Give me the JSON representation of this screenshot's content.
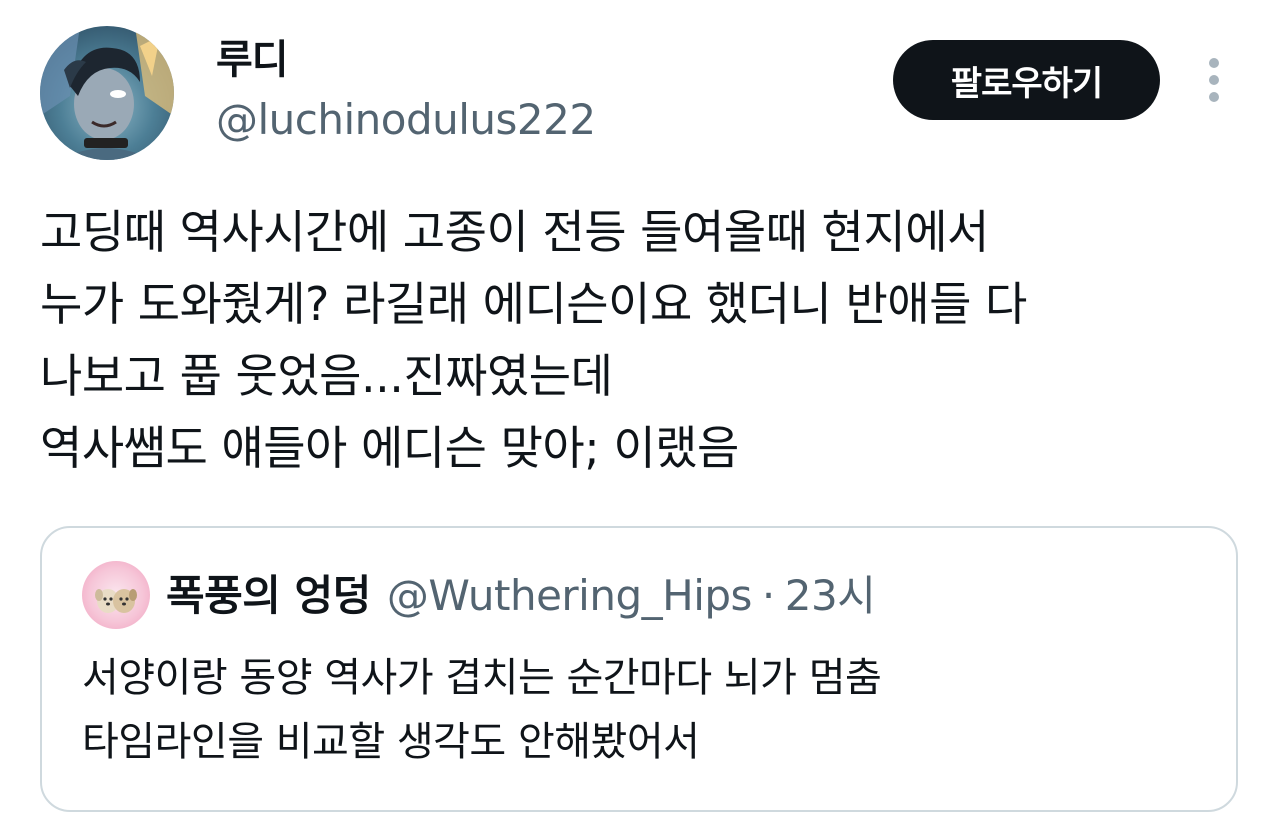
{
  "author": {
    "display_name": "루디",
    "handle": "@luchinodulus222",
    "avatar_icon": "profile-avatar"
  },
  "actions": {
    "follow_label": "팔로우하기",
    "more_icon": "more-vertical-icon"
  },
  "tweet": {
    "lines": [
      "고딩때 역사시간에 고종이 전등 들여올때 현지에서",
      "누가 도와줬게? 라길래 에디슨이요 했더니 반애들 다",
      "나보고 풉 웃었음...진짜였는데",
      "역사쌤도 얘들아 에디슨 맞아; 이랬음"
    ]
  },
  "quoted": {
    "display_name": "폭풍의 엉덩",
    "handle": "@Wuthering_Hips",
    "separator": "·",
    "time": "23시",
    "lines": [
      "서양이랑 동양 역사가 겹치는 순간마다 뇌가 멈춤",
      "타임라인을 비교할 생각도 안해봤어서"
    ]
  },
  "colors": {
    "text_primary": "#0f1419",
    "text_secondary": "#536471",
    "button_bg": "#0f1419",
    "border": "#cfd9de"
  }
}
